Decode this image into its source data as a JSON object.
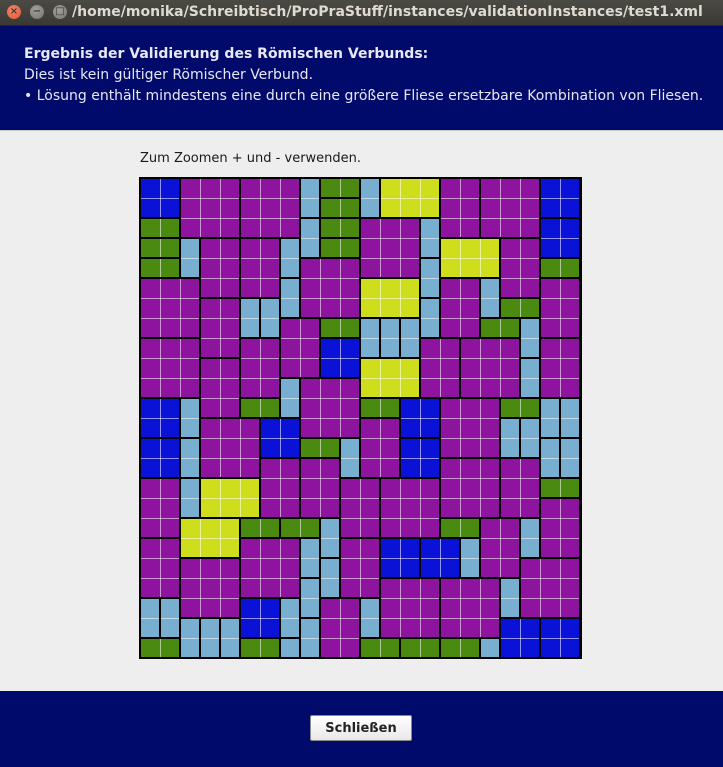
{
  "window": {
    "title": "/home/monika/Schreibtisch/ProPraStuff/instances/validationInstances/test1.xml",
    "close_glyph": "×",
    "minimize_glyph": "−",
    "maximize_glyph": "□"
  },
  "header": {
    "title": "Ergebnis der Validierung des Römischen Verbunds:",
    "line1": "Dies ist kein gültiger Römischer Verbund.",
    "line2": "• Lösung enthält mindestens eine durch eine größere Fliese ersetzbare Kombination von Fliesen."
  },
  "content": {
    "hint": "Zum Zoomen + und - verwenden."
  },
  "footer": {
    "close_label": "Schließen"
  },
  "colors": {
    "purple": "#8e14a0",
    "yellow": "#cedd1c",
    "green": "#4a8a10",
    "blue": "#0a12d8",
    "light_blue": "#78aed0",
    "header_bg": "#000a6b"
  }
}
